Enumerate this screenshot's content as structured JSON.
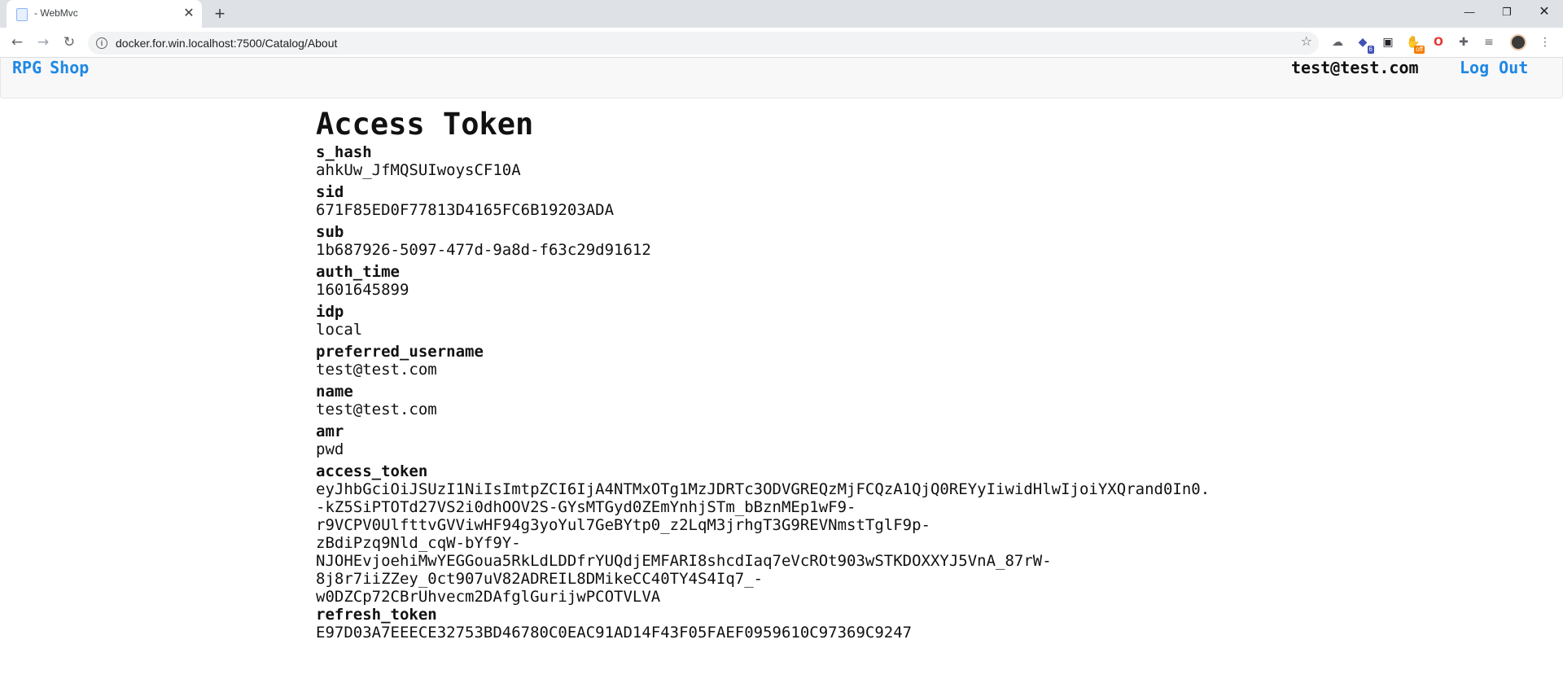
{
  "browser": {
    "tab_title": "- WebMvc",
    "url": "docker.for.win.localhost:7500/Catalog/About",
    "ext_badge_count": "6",
    "ext_badge_off": "off"
  },
  "nav": {
    "brand_rpg": "RPG",
    "brand_shop": "Shop",
    "user_email": "test@test.com",
    "logout_label": "Log Out"
  },
  "page": {
    "title": "Access Token"
  },
  "claims": [
    {
      "name": "s_hash",
      "value": "ahkUw_JfMQSUIwoysCF10A"
    },
    {
      "name": "sid",
      "value": "671F85ED0F77813D4165FC6B19203ADA"
    },
    {
      "name": "sub",
      "value": "1b687926-5097-477d-9a8d-f63c29d91612"
    },
    {
      "name": "auth_time",
      "value": "1601645899"
    },
    {
      "name": "idp",
      "value": "local"
    },
    {
      "name": "preferred_username",
      "value": "test@test.com"
    },
    {
      "name": "name",
      "value": "test@test.com"
    },
    {
      "name": "amr",
      "value": "pwd"
    }
  ],
  "access_token": {
    "name": "access_token",
    "lines": [
      "eyJhbGciOiJSUzI1NiIsImtpZCI6IjA4NTMxOTg1MzJDRTc3ODVGREQzMjFCQzA1QjQ0REYyIiwidHlwIjoiYXQrand0In0.",
      "-kZ5SiPTOTd27VS2i0dhOOV2S-GYsMTGyd0ZEmYnhjSTm_bBznMEp1wF9-",
      "r9VCPV0UlfttvGVViwHF94g3yoYul7GeBYtp0_z2LqM3jrhgT3G9REVNmstTglF9p-",
      "zBdiPzq9Nld_cqW-bYf9Y-",
      "NJOHEvjoehiMwYEGGoua5RkLdLDDfrYUQdjEMFARI8shcdIaq7eVcROt903wSTKDOXXYJ5VnA_87rW-",
      "8j8r7iiZZey_0ct907uV82ADREIL8DMikeCC40TY4S4Iq7_-",
      "w0DZCp72CBrUhvecm2DAfglGurijwPCOTVLVA"
    ]
  },
  "refresh_token": {
    "name": "refresh_token",
    "value": "E97D03A7EEECE32753BD46780C0EAC91AD14F43F05FAEF0959610C97369C9247"
  }
}
